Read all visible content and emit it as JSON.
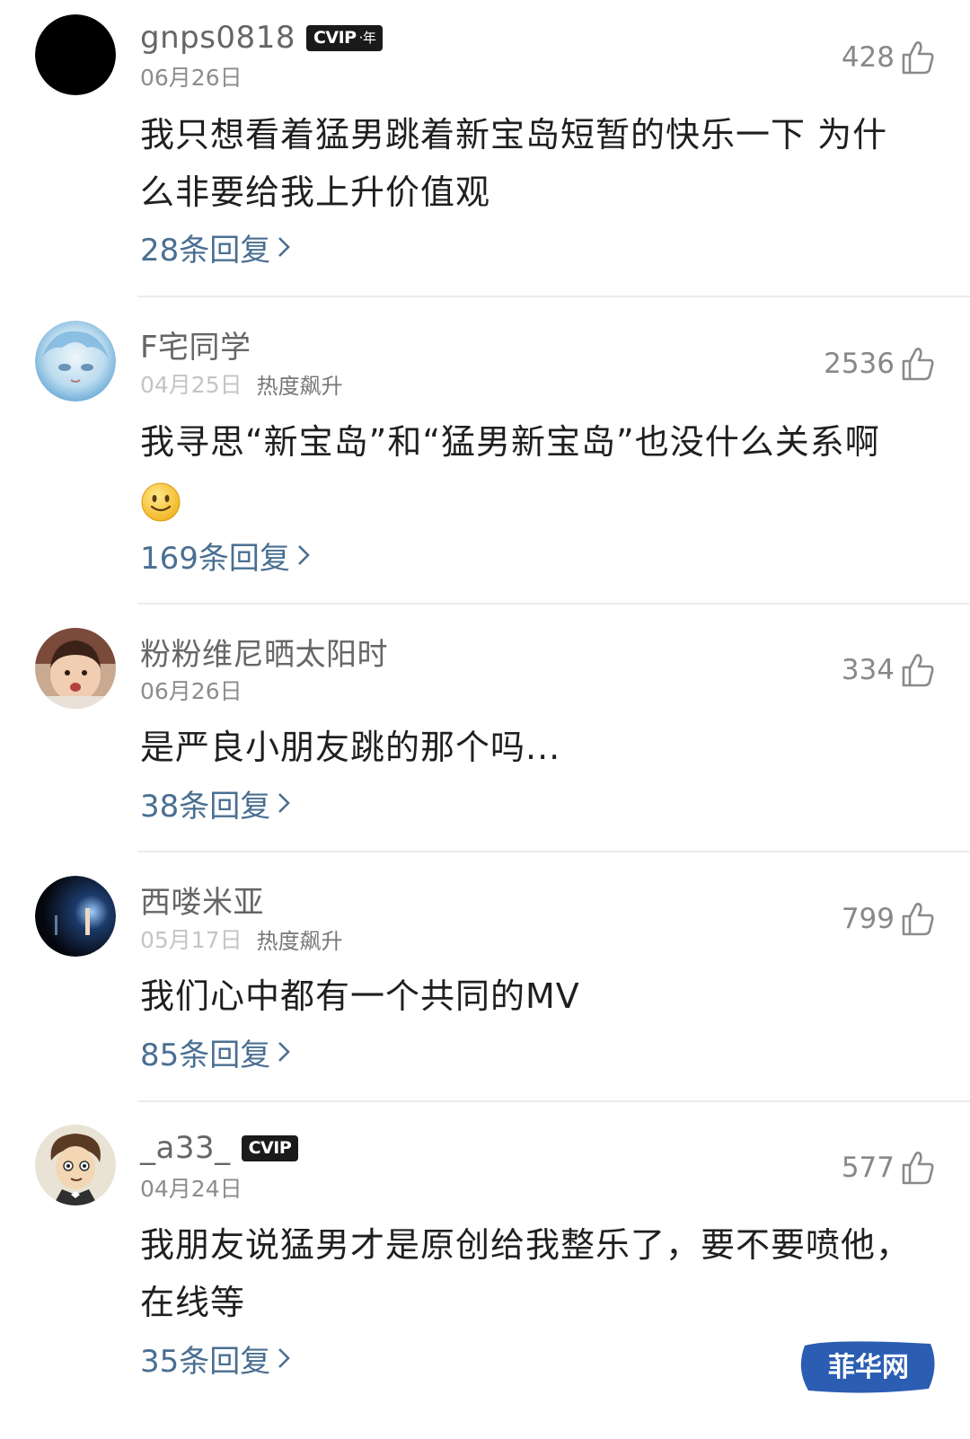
{
  "comments": [
    {
      "username": "gnps0818",
      "vip": {
        "label": "CVIP",
        "suffix": "·年"
      },
      "date": "06月26日",
      "tag": "",
      "likes": "428",
      "text": "我只想看着猛男跳着新宝岛短暂的快乐一下 为什么非要给我上升价值观",
      "replies": "28条回复"
    },
    {
      "username": "F宅同学",
      "date": "04月25日",
      "tag": "热度飙升",
      "likes": "2536",
      "text": "我寻思“新宝岛”和“猛男新宝岛”也没什么关系啊",
      "emoji": "smiley",
      "replies": "169条回复"
    },
    {
      "username": "粉粉维尼晒太阳时",
      "date": "06月26日",
      "tag": "",
      "likes": "334",
      "text": "是严良小朋友跳的那个吗...",
      "replies": "38条回复"
    },
    {
      "username": "西喽米亚",
      "date": "05月17日",
      "tag": "热度飙升",
      "likes": "799",
      "text": "我们心中都有一个共同的MV",
      "replies": "85条回复"
    },
    {
      "username": "_a33_",
      "vip": {
        "label": "CVIP",
        "suffix": ""
      },
      "date": "04月24日",
      "tag": "",
      "likes": "577",
      "text": "我朋友说猛男才是原创给我整乐了，要不要喷他，在线等",
      "replies": "35条回复"
    }
  ],
  "watermark": "菲华网",
  "colors": {
    "reply_link": "#4a6f92",
    "divider": "#ececec",
    "watermark_bg": "#2b5db3"
  },
  "icons": {
    "like": "thumbs-up-icon",
    "reply_arrow": "chevron-right-icon"
  }
}
